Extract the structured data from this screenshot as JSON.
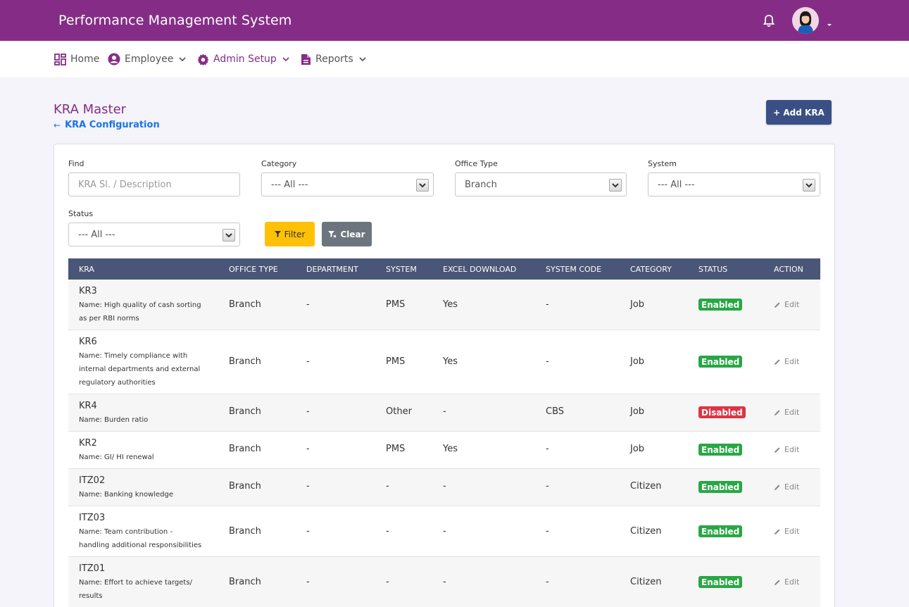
{
  "app": {
    "title": "Performance Management System"
  },
  "nav": {
    "home": "Home",
    "employee": "Employee",
    "admin_setup": "Admin Setup",
    "reports": "Reports"
  },
  "page": {
    "title": "KRA Master",
    "back_link": "KRA Configuration",
    "add_button": "+ Add KRA"
  },
  "filters": {
    "find_label": "Find",
    "find_placeholder": "KRA Sl. / Description",
    "category_label": "Category",
    "category_value": "--- All ---",
    "office_type_label": "Office Type",
    "office_type_value": "Branch",
    "system_label": "System",
    "system_value": "--- All ---",
    "status_label": "Status",
    "status_value": "--- All ---",
    "filter_button": "Filter",
    "clear_button": "Clear"
  },
  "table": {
    "headers": [
      "KRA",
      "OFFICE TYPE",
      "DEPARTMENT",
      "SYSTEM",
      "EXCEL DOWNLOAD",
      "SYSTEM CODE",
      "CATEGORY",
      "STATUS",
      "ACTION"
    ],
    "rows": [
      {
        "code": "KR3",
        "name_lines": [
          "Name: High quality of cash sorting",
          "as per RBI norms"
        ],
        "office_type": "Branch",
        "department": "-",
        "system": "PMS",
        "excel": "Yes",
        "system_code": "-",
        "category": "Job",
        "status": "Enabled",
        "action": "Edit"
      },
      {
        "code": "KR6",
        "name_lines": [
          "Name: Timely compliance with",
          "internal departments and external",
          "regulatory authorities"
        ],
        "office_type": "Branch",
        "department": "-",
        "system": "PMS",
        "excel": "Yes",
        "system_code": "-",
        "category": "Job",
        "status": "Enabled",
        "action": "Edit"
      },
      {
        "code": "KR4",
        "name_lines": [
          "Name: Burden ratio"
        ],
        "office_type": "Branch",
        "department": "-",
        "system": "Other",
        "excel": "-",
        "system_code": "CBS",
        "category": "Job",
        "status": "Disabled",
        "action": "Edit"
      },
      {
        "code": "KR2",
        "name_lines": [
          "Name: GI/ HI renewal"
        ],
        "office_type": "Branch",
        "department": "-",
        "system": "PMS",
        "excel": "Yes",
        "system_code": "-",
        "category": "Job",
        "status": "Enabled",
        "action": "Edit"
      },
      {
        "code": "ITZ02",
        "name_lines": [
          "Name: Banking knowledge"
        ],
        "office_type": "Branch",
        "department": "-",
        "system": "-",
        "excel": "-",
        "system_code": "-",
        "category": "Citizen",
        "status": "Enabled",
        "action": "Edit"
      },
      {
        "code": "ITZ03",
        "name_lines": [
          "Name: Team contribution -",
          "handling additional responsibilities"
        ],
        "office_type": "Branch",
        "department": "-",
        "system": "-",
        "excel": "-",
        "system_code": "-",
        "category": "Citizen",
        "status": "Enabled",
        "action": "Edit"
      },
      {
        "code": "ITZ01",
        "name_lines": [
          "Name: Effort to achieve targets/",
          "results"
        ],
        "office_type": "Branch",
        "department": "-",
        "system": "-",
        "excel": "-",
        "system_code": "-",
        "category": "Citizen",
        "status": "Enabled",
        "action": "Edit"
      }
    ]
  },
  "colors": {
    "brand": "#852d86",
    "header_bg": "#4a5677",
    "enabled": "#28a745",
    "disabled": "#dc3545",
    "filter": "#ffc107"
  }
}
